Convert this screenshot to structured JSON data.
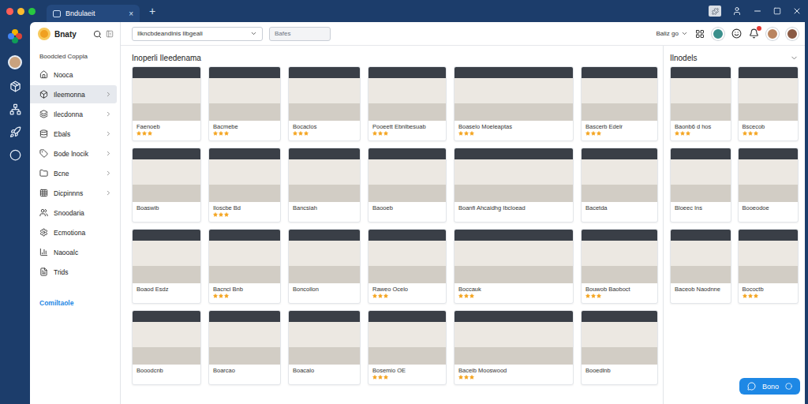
{
  "window": {
    "tab_title": "Bndulaeit",
    "tab_close": "×",
    "new_tab": "+"
  },
  "app": {
    "name": "Bnaty"
  },
  "sidebar": {
    "heading": "Boodcled Coppla",
    "items": [
      {
        "label": "Nooca",
        "selected": false,
        "expandable": false
      },
      {
        "label": "Ileemonna",
        "selected": true,
        "expandable": true
      },
      {
        "label": "Ilecdonna",
        "selected": false,
        "expandable": true
      },
      {
        "label": "Ebals",
        "selected": false,
        "expandable": true
      },
      {
        "label": "Bode lnocik",
        "selected": false,
        "expandable": true
      },
      {
        "label": "Bcne",
        "selected": false,
        "expandable": true
      },
      {
        "label": "Dicpinnns",
        "selected": false,
        "expandable": true
      },
      {
        "label": "Snoodaria",
        "selected": false,
        "expandable": false
      },
      {
        "label": "Ecmotiona",
        "selected": false,
        "expandable": false
      },
      {
        "label": "Naooalc",
        "selected": false,
        "expandable": false
      },
      {
        "label": "Trids",
        "selected": false,
        "expandable": false
      }
    ],
    "link": "Comiltaole"
  },
  "toolbar": {
    "category_select": "Ilkncbdeandlnis Ilbgeali",
    "search_placeholder": "Bafes",
    "view_select": "Baliz go",
    "notification_badge": true
  },
  "main": {
    "title": "Inoperli Ileedenama",
    "cards": [
      {
        "caption": "Faenoeb",
        "stars": 3
      },
      {
        "caption": "Bacmebe",
        "stars": 3
      },
      {
        "caption": "Bocaclos",
        "stars": 3
      },
      {
        "caption": "Pooeett Ebnlbesuab",
        "stars": 3
      },
      {
        "caption": "Boaselo Moeleaptas",
        "stars": 3
      },
      {
        "caption": "Bascerb Edelr",
        "stars": 3
      },
      {
        "caption": "Boaswib",
        "stars": 0
      },
      {
        "caption": "Iloscbe Bd",
        "stars": 3
      },
      {
        "caption": "Bancsiah",
        "stars": 0
      },
      {
        "caption": "Baooeb",
        "stars": 0
      },
      {
        "caption": "Boanfi Ahcaidhg Ibcloead",
        "stars": 0
      },
      {
        "caption": "Bacetda",
        "stars": 0
      },
      {
        "caption": "Boaod Esdz",
        "stars": 0
      },
      {
        "caption": "Bacnci Bnb",
        "stars": 3
      },
      {
        "caption": "Boncollon",
        "stars": 0
      },
      {
        "caption": "Raweo Ocelo",
        "stars": 3
      },
      {
        "caption": "Boccauk",
        "stars": 3
      },
      {
        "caption": "Bouwob Baoboct",
        "stars": 3
      },
      {
        "caption": "Booodcnb",
        "stars": 0
      },
      {
        "caption": "Boarcao",
        "stars": 0
      },
      {
        "caption": "Boacalo",
        "stars": 0
      },
      {
        "caption": "Bosemio OE",
        "stars": 3
      },
      {
        "caption": "Baceib Mooswood",
        "stars": 3
      },
      {
        "caption": "Booedlnb",
        "stars": 0
      }
    ]
  },
  "right_panel": {
    "title": "Ilnodels",
    "cards": [
      {
        "caption": "Baonb6 d hos",
        "stars": 3
      },
      {
        "caption": "Bscecob",
        "stars": 3
      },
      {
        "caption": "Bloeec Ins",
        "stars": 0
      },
      {
        "caption": "Booeodoe",
        "stars": 0
      },
      {
        "caption": "Baceob Naodnne",
        "stars": 0
      },
      {
        "caption": "Bococtb",
        "stars": 3
      }
    ]
  },
  "fab": {
    "label": "Bono"
  }
}
